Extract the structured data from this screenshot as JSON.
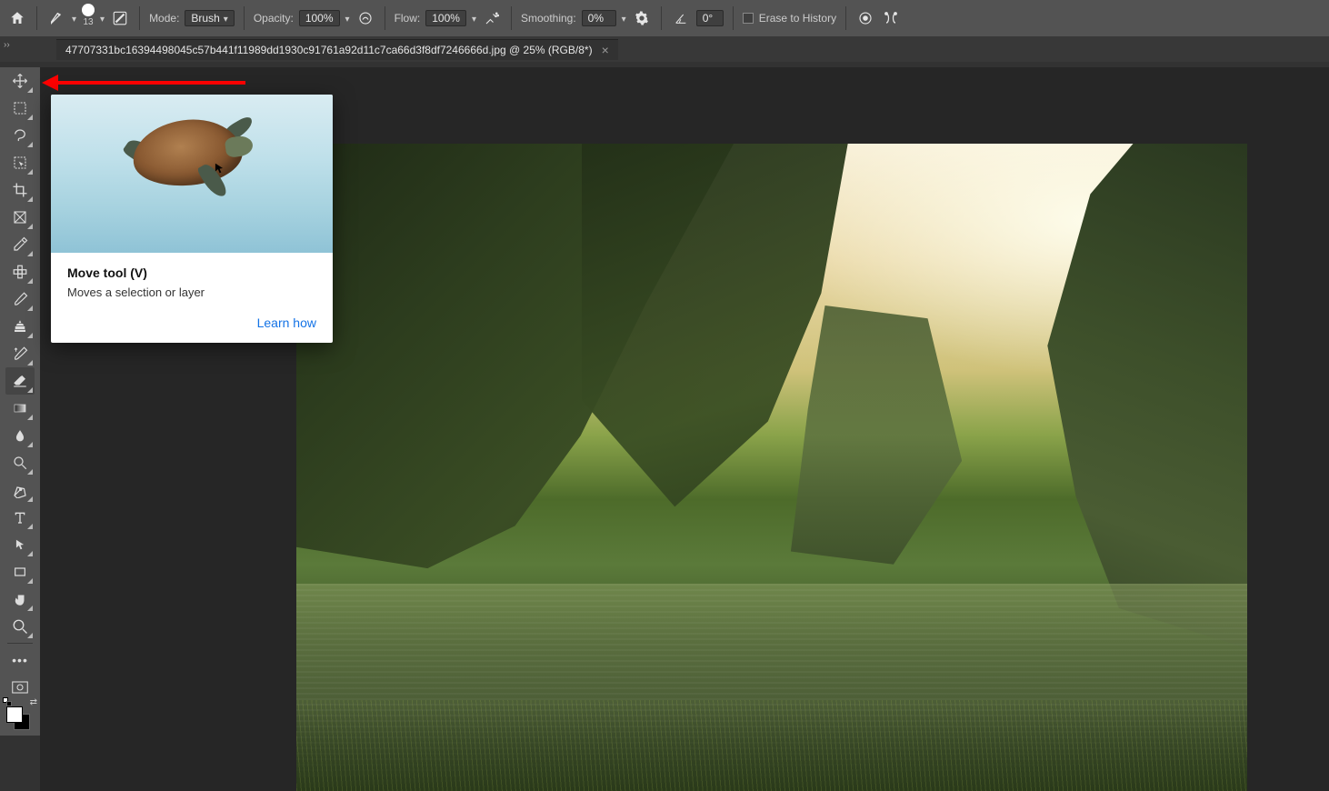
{
  "options_bar": {
    "brush_size": "13",
    "mode_label": "Mode:",
    "mode_value": "Brush",
    "opacity_label": "Opacity:",
    "opacity_value": "100%",
    "flow_label": "Flow:",
    "flow_value": "100%",
    "smoothing_label": "Smoothing:",
    "smoothing_value": "0%",
    "angle_value": "0°",
    "erase_history_label": "Erase to History"
  },
  "tab": {
    "title": "47707331bc16394498045c57b441f11989dd1930c91761a92d11c7ca66d3f8df7246666d.jpg @ 25% (RGB/8*)"
  },
  "tooltip": {
    "title": "Move tool (V)",
    "description": "Moves a selection or layer",
    "link": "Learn how"
  },
  "tools": [
    {
      "name": "move-tool",
      "active": false
    },
    {
      "name": "marquee-tool",
      "active": false
    },
    {
      "name": "lasso-tool",
      "active": false
    },
    {
      "name": "object-selection-tool",
      "active": false
    },
    {
      "name": "crop-tool",
      "active": false
    },
    {
      "name": "frame-tool",
      "active": false
    },
    {
      "name": "eyedropper-tool",
      "active": false
    },
    {
      "name": "healing-brush-tool",
      "active": false
    },
    {
      "name": "brush-tool",
      "active": false
    },
    {
      "name": "clone-stamp-tool",
      "active": false
    },
    {
      "name": "history-brush-tool",
      "active": false
    },
    {
      "name": "eraser-tool",
      "active": true
    },
    {
      "name": "gradient-tool",
      "active": false
    },
    {
      "name": "blur-tool",
      "active": false
    },
    {
      "name": "dodge-tool",
      "active": false
    },
    {
      "name": "pen-tool",
      "active": false
    },
    {
      "name": "type-tool",
      "active": false
    },
    {
      "name": "path-selection-tool",
      "active": false
    },
    {
      "name": "rectangle-tool",
      "active": false
    },
    {
      "name": "hand-tool",
      "active": false
    },
    {
      "name": "zoom-tool",
      "active": false
    }
  ]
}
